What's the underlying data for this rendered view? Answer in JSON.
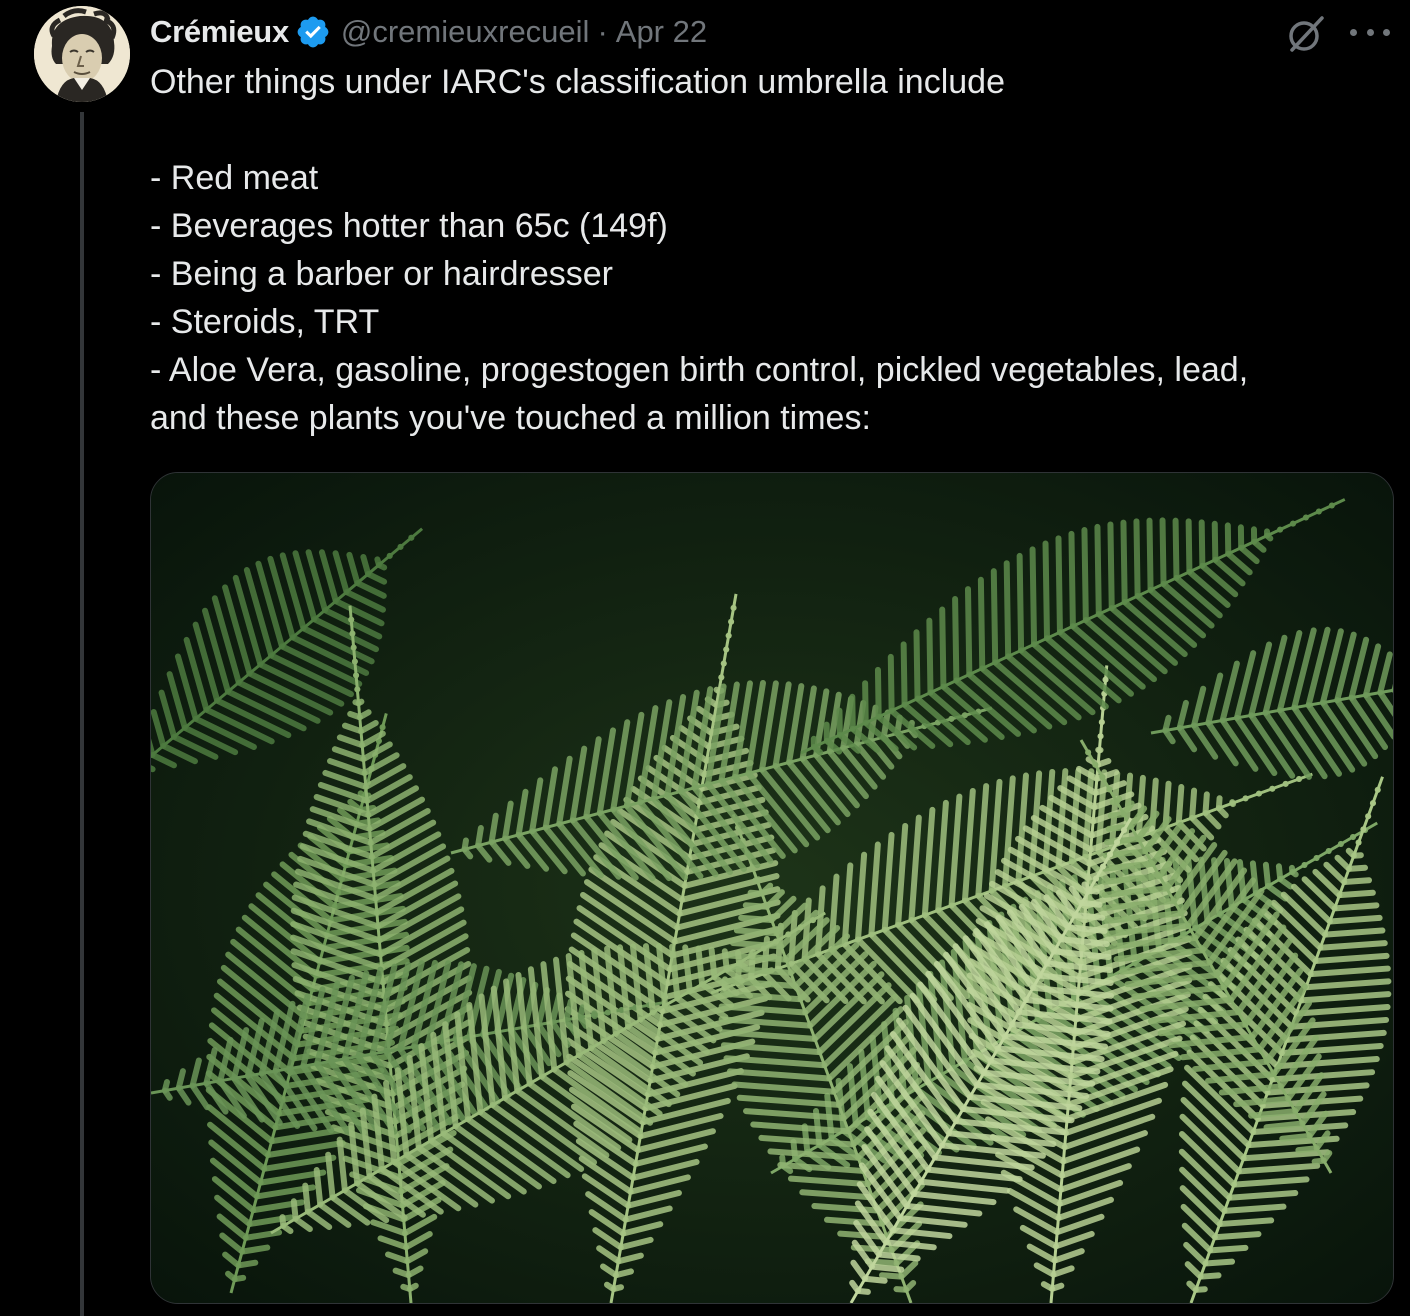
{
  "author": {
    "display_name": "Crémieux",
    "handle": "@cremieuxrecueil",
    "separator": "·",
    "date": "Apr 22",
    "verified": true,
    "avatar_icon": "portrait-avatar"
  },
  "tweet": {
    "lines": [
      "Other things under IARC's classification umbrella include",
      "",
      "- Red meat",
      "- Beverages hotter than 65c (149f)",
      "- Being a barber or hairdresser",
      "- Steroids, TRT",
      "- Aloe Vera, gasoline, progestogen birth control, pickled vegetables, lead,",
      "and these plants you've touched a million times:"
    ]
  },
  "media": {
    "subject": "fern-fronds-photo"
  },
  "icons": {
    "verified": "verified-badge-icon",
    "grok": "grok-icon",
    "more": "more-options-icon"
  },
  "colors": {
    "background": "#000000",
    "text_primary": "#e7e9ea",
    "text_secondary": "#71767b",
    "verified_blue": "#1d9bf0",
    "thread_line": "#333639"
  }
}
